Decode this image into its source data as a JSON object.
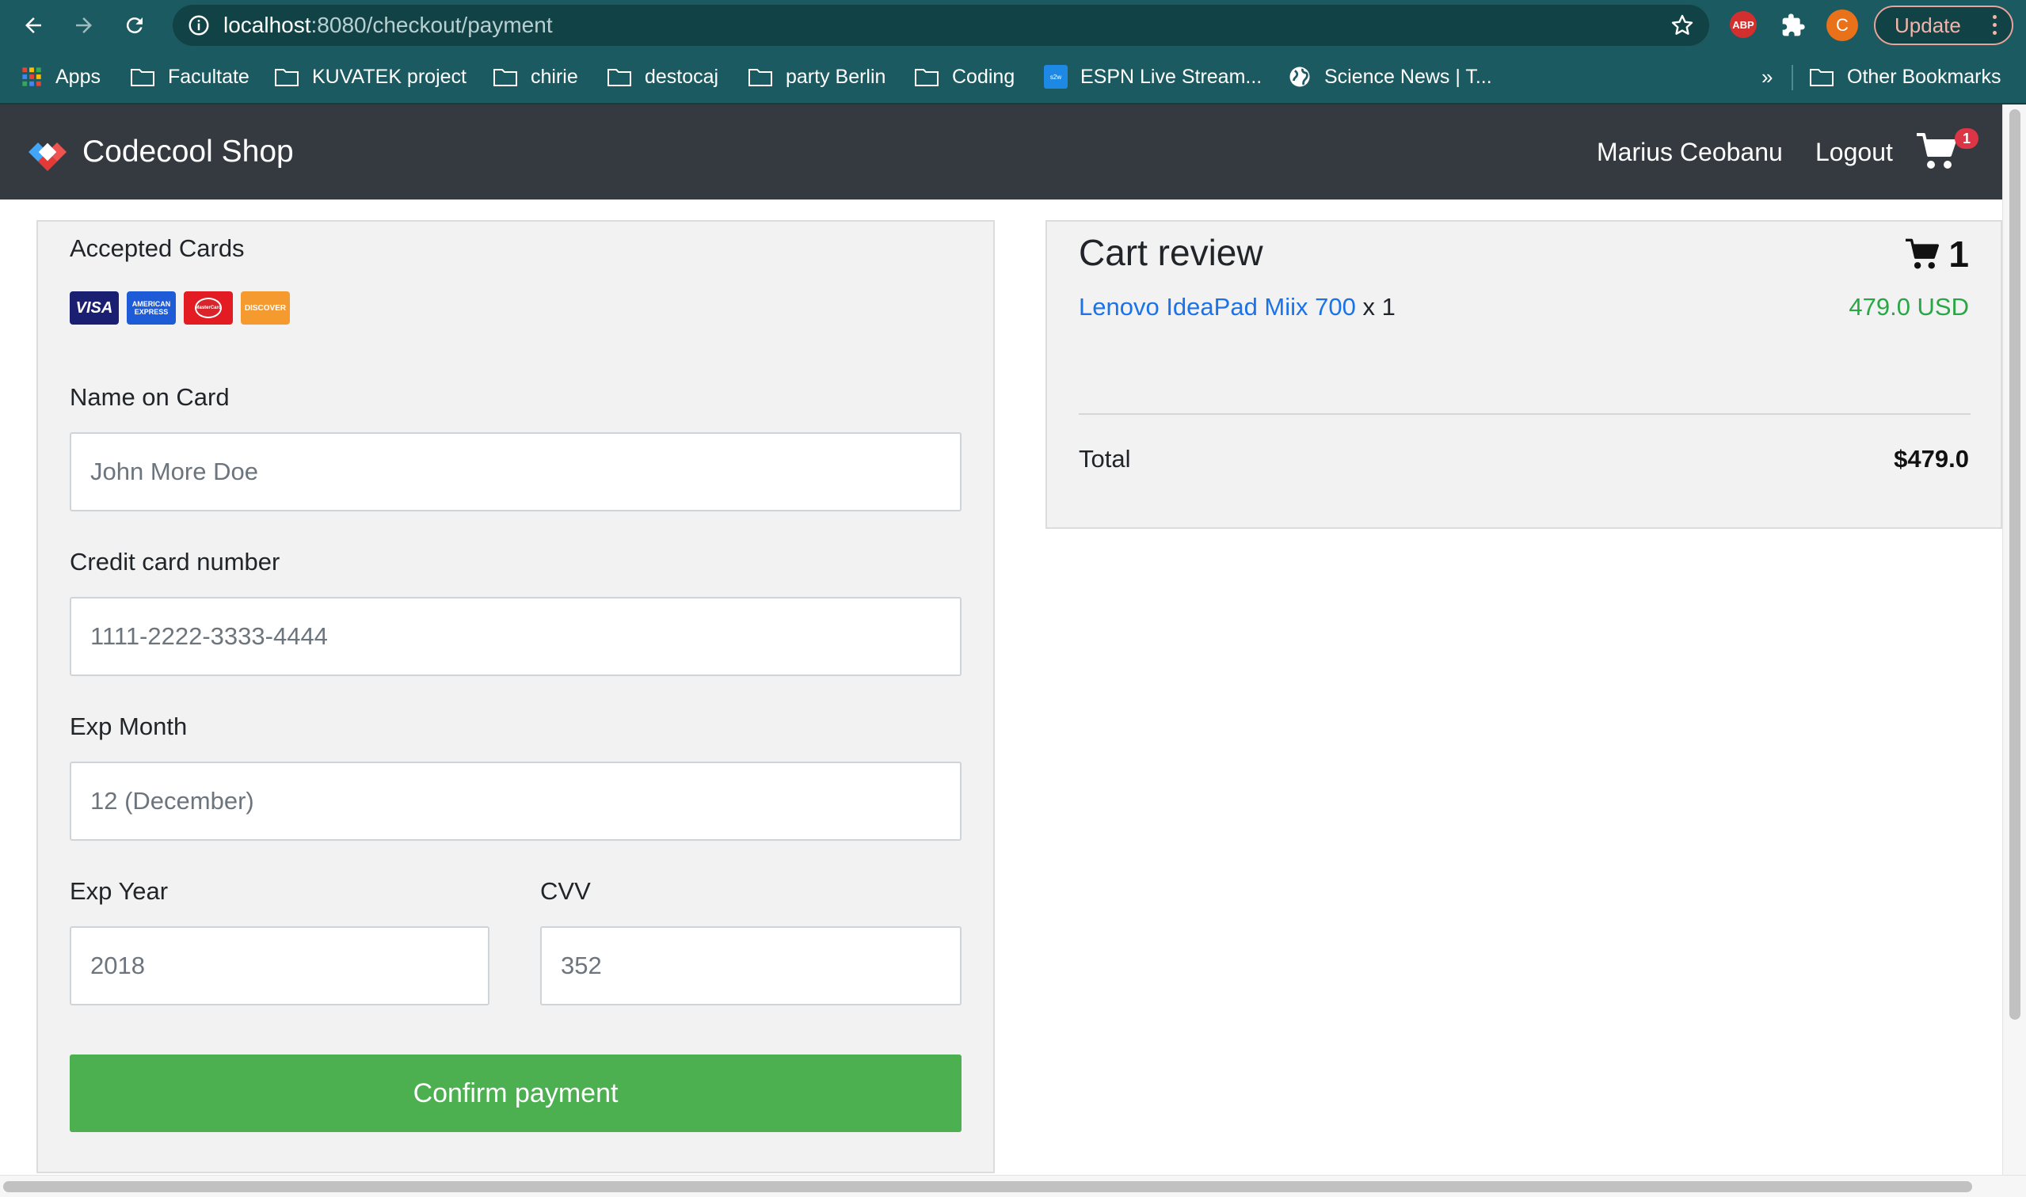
{
  "browser": {
    "url_host": "localhost",
    "url_rest": ":8080/checkout/payment",
    "abp_label": "ABP",
    "profile_initial": "C",
    "update_label": "Update",
    "bookmarks": [
      {
        "label": "Apps",
        "icon": "apps-grid-icon"
      },
      {
        "label": "Facultate",
        "icon": "folder-icon"
      },
      {
        "label": "KUVATEK project",
        "icon": "folder-icon"
      },
      {
        "label": "chirie",
        "icon": "folder-icon"
      },
      {
        "label": "destocaj",
        "icon": "folder-icon"
      },
      {
        "label": "party Berlin",
        "icon": "folder-icon"
      },
      {
        "label": "Coding",
        "icon": "folder-icon"
      },
      {
        "label": "ESPN Live Stream...",
        "icon": "site-favicon-icon"
      },
      {
        "label": "Science News | T...",
        "icon": "globe-icon"
      }
    ],
    "overflow_label": "»",
    "other_bookmarks_label": "Other Bookmarks"
  },
  "navbar": {
    "brand": "Codecool Shop",
    "user": "Marius Ceobanu",
    "logout": "Logout",
    "cart_badge": "1"
  },
  "payment": {
    "accepted_cards_label": "Accepted Cards",
    "cards": [
      {
        "name": "VISA",
        "color": "#1a1f71"
      },
      {
        "name": "AMERICAN EXPRESS",
        "color": "#1e5bd6"
      },
      {
        "name": "MasterCard",
        "color": "#e31b23"
      },
      {
        "name": "DISCOVER",
        "color": "#f59a2f"
      }
    ],
    "name_label": "Name on Card",
    "name_placeholder": "John More Doe",
    "cc_label": "Credit card number",
    "cc_placeholder": "1111-2222-3333-4444",
    "exp_month_label": "Exp Month",
    "exp_month_placeholder": "12 (December)",
    "exp_year_label": "Exp Year",
    "exp_year_placeholder": "2018",
    "cvv_label": "CVV",
    "cvv_placeholder": "352",
    "confirm_label": "Confirm payment",
    "confirm_color": "#4caf50"
  },
  "cart_review": {
    "title": "Cart review",
    "count": "1",
    "items": [
      {
        "name": "Lenovo IdeaPad Miix 700",
        "qty": "x 1",
        "price": "479.0 USD"
      }
    ],
    "total_label": "Total",
    "total_value": "$479.0"
  }
}
